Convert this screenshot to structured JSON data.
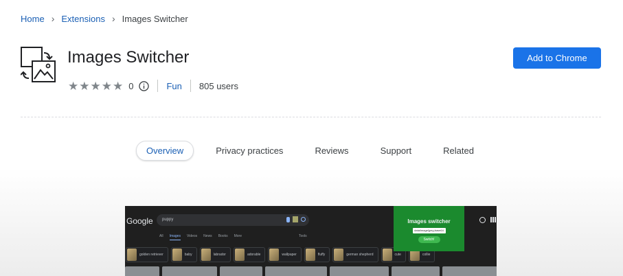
{
  "breadcrumb": {
    "items": [
      "Home",
      "Extensions",
      "Images Switcher"
    ]
  },
  "extension": {
    "title": "Images Switcher",
    "rating": 0,
    "rating_count": "0",
    "category": "Fun",
    "users": "805 users",
    "add_button_label": "Add to Chrome"
  },
  "tabs": [
    {
      "label": "Overview",
      "active": true
    },
    {
      "label": "Privacy practices",
      "active": false
    },
    {
      "label": "Reviews",
      "active": false
    },
    {
      "label": "Support",
      "active": false
    },
    {
      "label": "Related",
      "active": false
    }
  ],
  "screenshot": {
    "logo": "Google",
    "search_query": "puppy",
    "filters": [
      "All",
      "Images",
      "Videos",
      "News",
      "Books",
      "More"
    ],
    "tools": "Tools",
    "chips": [
      "golden retriever",
      "baby",
      "labrador",
      "adorable",
      "wallpaper",
      "fluffy",
      "german shepherd",
      "cute",
      "collie"
    ],
    "popup": {
      "title": "Images switcher",
      "input_value": "data/image/jpeg;base64",
      "button": "Switch!"
    }
  },
  "colors": {
    "accent": "#1a73e8",
    "link": "#1a5fb4",
    "popup_bg": "#1b8a2e"
  }
}
